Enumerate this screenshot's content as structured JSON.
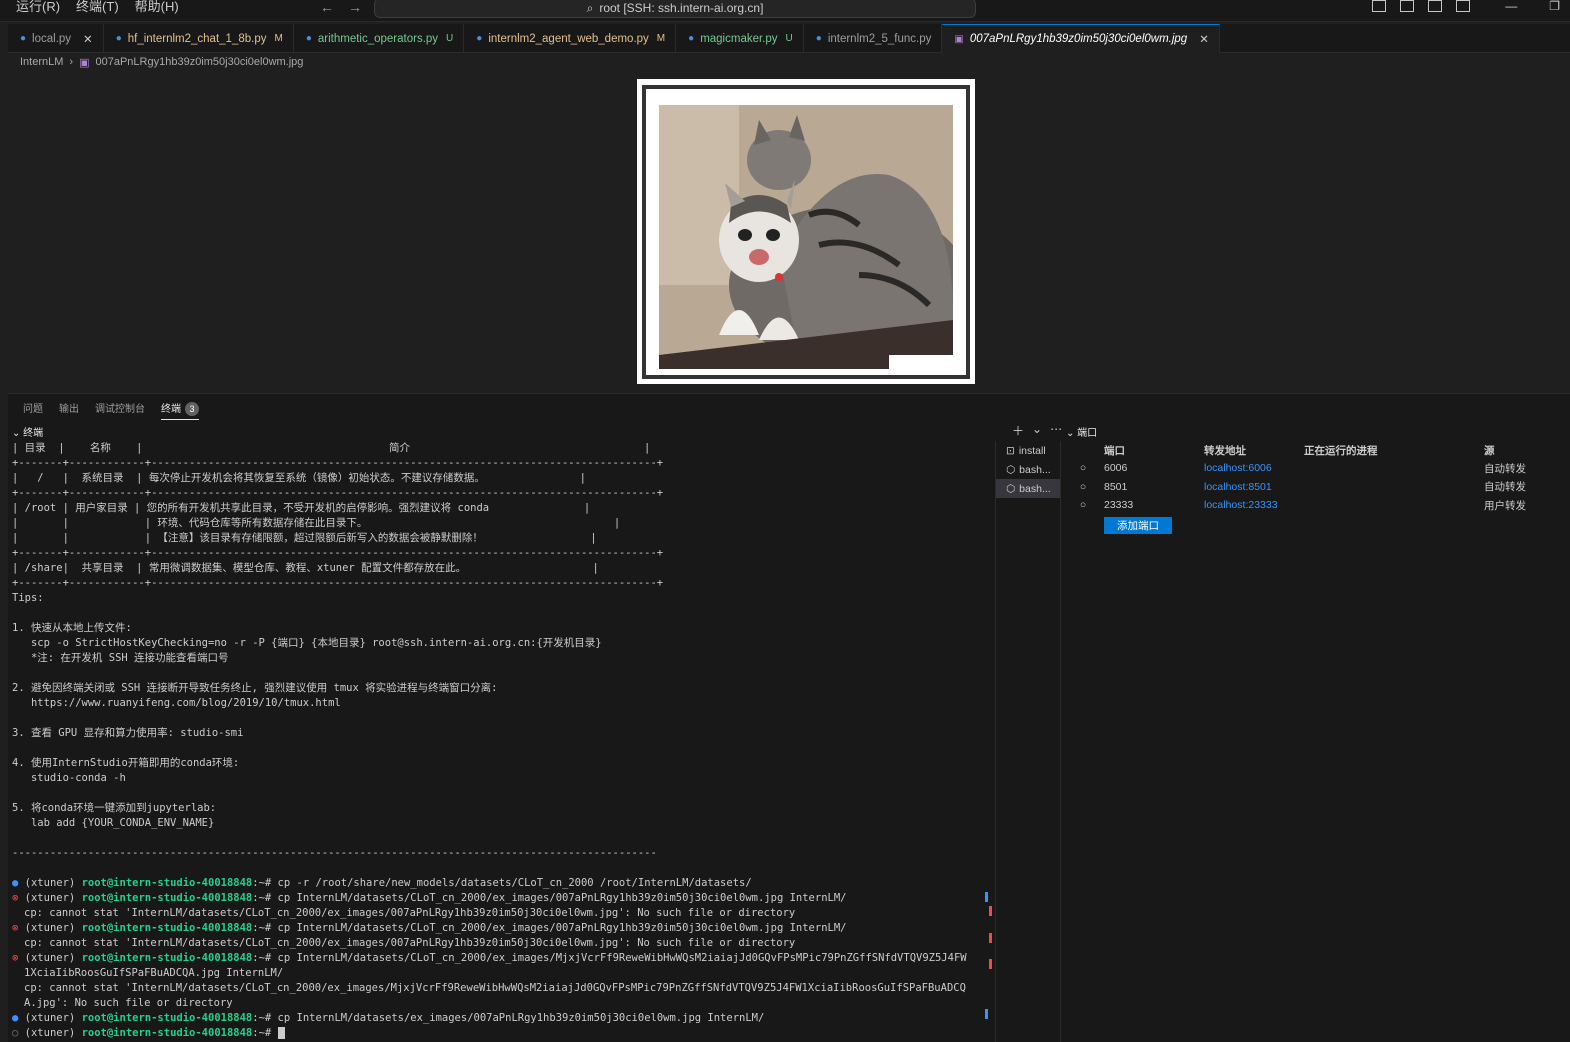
{
  "menu": [
    "运行(R)",
    "终端(T)",
    "帮助(H)"
  ],
  "command_center": "root [SSH: ssh.intern-ai.org.cn]",
  "tabs": [
    {
      "label": "local.py",
      "badge": ""
    },
    {
      "label": "hf_internlm2_chat_1_8b.py",
      "badge": "M"
    },
    {
      "label": "arithmetic_operators.py",
      "badge": "U"
    },
    {
      "label": "internlm2_agent_web_demo.py",
      "badge": "M"
    },
    {
      "label": "magicmaker.py",
      "badge": "U"
    },
    {
      "label": "internlm2_5_func.py",
      "badge": ""
    },
    {
      "label": "007aPnLRgy1hb39z0im50j30ci0el0wm.jpg",
      "badge": ""
    }
  ],
  "breadcrumb": {
    "folder": "InternLM",
    "file": "007aPnLRgy1hb39z0im50j30ci0el0wm.jpg"
  },
  "panel": {
    "tabs": [
      "问题",
      "输出",
      "调试控制台",
      "终端"
    ],
    "terminal_count": "3",
    "terminal_header": "终端",
    "ports_header": "端口"
  },
  "terminal_lines": [
    "| 目录  |    名称    |                                       简介                                     |",
    "+-------+------------+--------------------------------------------------------------------------------+",
    "|   /   |  系统目录  | 每次停止开发机会将其恢复至系统（镜像）初始状态。不建议存储数据。               |",
    "+-------+------------+--------------------------------------------------------------------------------+",
    "| /root | 用户家目录 | 您的所有开发机共享此目录，不受开发机的启停影响。强烈建议将 conda               |",
    "|       |            | 环境、代码仓库等所有数据存储在此目录下。                                       |",
    "|       |            | 【注意】该目录有存储限额，超过限额后新写入的数据会被静默删除！                 |",
    "+-------+------------+--------------------------------------------------------------------------------+",
    "| /share|  共享目录  | 常用微调数据集、模型仓库、教程、xtuner 配置文件都存放在此。                    |",
    "+-------+------------+--------------------------------------------------------------------------------+",
    "Tips:",
    "",
    "1. 快速从本地上传文件:",
    "   scp -o StrictHostKeyChecking=no -r -P {端口} {本地目录} root@ssh.intern-ai.org.cn:{开发机目录}",
    "   *注: 在开发机 SSH 连接功能查看端口号",
    "",
    "2. 避免因终端关闭或 SSH 连接断开导致任务终止, 强烈建议使用 tmux 将实验进程与终端窗口分离:",
    "   https://www.ruanyifeng.com/blog/2019/10/tmux.html",
    "",
    "3. 查看 GPU 显存和算力使用率: studio-smi",
    "",
    "4. 使用InternStudio开箱即用的conda环境:",
    "   studio-conda -h",
    "",
    "5. 将conda环境一键添加到jupyterlab:",
    "   lab add {YOUR_CONDA_ENV_NAME}",
    "",
    "------------------------------------------------------------------------------------------------------",
    ""
  ],
  "commands": {
    "env": "(xtuner) ",
    "prompt": "root@intern-studio-40018848",
    "suffix": ":~# ",
    "cmd1": "cp -r /root/share/new_models/datasets/CLoT_cn_2000 /root/InternLM/datasets/",
    "cmd2": "cp InternLM/datasets/CLoT_cn_2000/ex_images/007aPnLRgy1hb39z0im50j30ci0el0wm.jpg InternLM/",
    "err2": "cp: cannot stat 'InternLM/datasets/CLoT_cn_2000/ex_images/007aPnLRgy1hb39z0im50j30ci0el0wm.jpg': No such file or directory",
    "cmd3": "cp InternLM/datasets/CLoT_cn_2000/ex_images/007aPnLRgy1hb39z0im50j30ci0el0wm.jpg InternLM/",
    "err3": "cp: cannot stat 'InternLM/datasets/CLoT_cn_2000/ex_images/007aPnLRgy1hb39z0im50j30ci0el0wm.jpg': No such file or directory",
    "cmd4": "cp InternLM/datasets/CLoT_cn_2000/ex_images/MjxjVcrFf9ReweWibHwWQsM2iaiajJd0GQvFPsMPic79PnZGffSNfdVTQV9Z5J4FW",
    "cmd4b": "1XciaIibRoosGuIfSPaFBuADCQA.jpg InternLM/",
    "err4": "cp: cannot stat 'InternLM/datasets/CLoT_cn_2000/ex_images/MjxjVcrFf9ReweWibHwWQsM2iaiajJd0GQvFPsMPic79PnZGffSNfdVTQV9Z5J4FW1XciaIibRoosGuIfSPaFBuADCQ",
    "err4b": "A.jpg': No such file or directory",
    "cmd5": "cp InternLM/datasets/ex_images/007aPnLRgy1hb39z0im50j30ci0el0wm.jpg InternLM/"
  },
  "terminal_list": [
    "install",
    "bash...",
    "bash..."
  ],
  "ports": {
    "columns": [
      "端口",
      "转发地址",
      "正在运行的进程",
      "源"
    ],
    "rows": [
      {
        "port": "6006",
        "address": "localhost:6006",
        "process": "",
        "source": "自动转发"
      },
      {
        "port": "8501",
        "address": "localhost:8501",
        "process": "",
        "source": "自动转发"
      },
      {
        "port": "23333",
        "address": "localhost:23333",
        "process": "",
        "source": "用户转发"
      }
    ],
    "add_button": "添加端口"
  }
}
